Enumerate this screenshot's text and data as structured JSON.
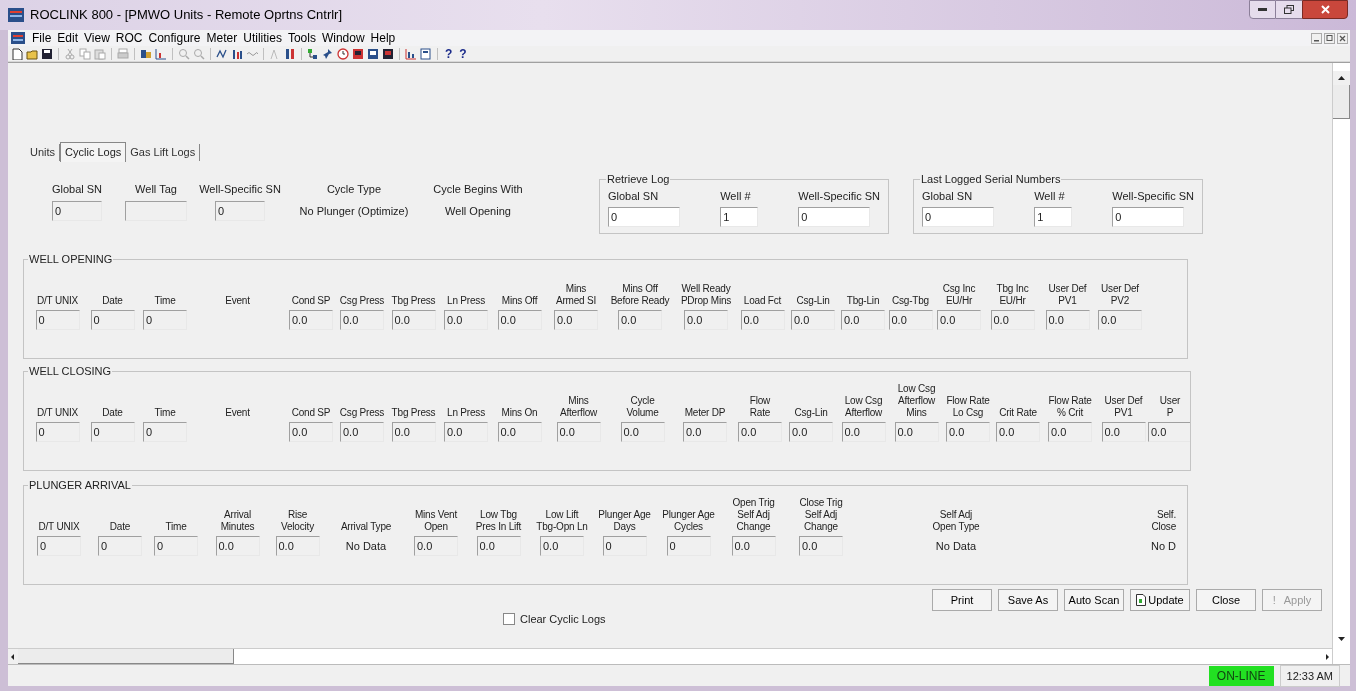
{
  "window": {
    "title": "ROCLINK 800 - [PMWO Units - Remote Oprtns Cntrlr]"
  },
  "menu": [
    "File",
    "Edit",
    "View",
    "ROC",
    "Configure",
    "Meter",
    "Utilities",
    "Tools",
    "Window",
    "Help"
  ],
  "toolbar_glyphs": [
    "?",
    "?"
  ],
  "tabs": [
    {
      "label": "Units",
      "selected": false
    },
    {
      "label": "Cyclic Logs",
      "selected": true
    },
    {
      "label": "Gas Lift Logs",
      "selected": false
    }
  ],
  "header_fields": [
    {
      "label": "Global SN",
      "kind": "field",
      "value": "0"
    },
    {
      "label": "Well Tag",
      "kind": "field"
    },
    {
      "label": "Well-Specific  SN",
      "kind": "field",
      "value": "0"
    },
    {
      "label": "Cycle Type",
      "kind": "text",
      "value": "No Plunger (Optimize)"
    },
    {
      "label": "Cycle Begins With",
      "kind": "text",
      "value": "Well Opening"
    }
  ],
  "retrieve_log": {
    "title": "Retrieve Log",
    "fields": [
      {
        "label": "Global SN",
        "value": "0"
      },
      {
        "label": "Well #",
        "value": "1"
      },
      {
        "label": "Well-Specific SN",
        "value": "0"
      }
    ]
  },
  "last_logged": {
    "title": "Last Logged Serial Numbers",
    "fields": [
      {
        "label": "Global SN",
        "value": "0"
      },
      {
        "label": "Well #",
        "value": "1"
      },
      {
        "label": "Well-Specific SN",
        "value": "0"
      }
    ]
  },
  "sections": [
    {
      "title": "WELL OPENING",
      "columns": [
        {
          "label": "D/T UNIX",
          "kind": "field",
          "value": "0"
        },
        {
          "label": "Date",
          "kind": "field",
          "value": "0"
        },
        {
          "label": "Time",
          "kind": "field",
          "value": "0"
        },
        {
          "label": "Event",
          "kind": "text"
        },
        {
          "label": "Cond SP",
          "kind": "field",
          "value": "0.0"
        },
        {
          "label": "Csg Press",
          "kind": "field",
          "value": "0.0"
        },
        {
          "label": "Tbg Press",
          "kind": "field",
          "value": "0.0"
        },
        {
          "label": "Ln Press",
          "kind": "field",
          "value": "0.0"
        },
        {
          "label": "Mins Off",
          "kind": "field",
          "value": "0.0"
        },
        {
          "label": "Mins\nArmed SI",
          "kind": "field",
          "value": "0.0"
        },
        {
          "label": "Mins Off\nBefore Ready",
          "kind": "field",
          "value": "0.0"
        },
        {
          "label": "Well Ready\nPDrop Mins",
          "kind": "field",
          "value": "0.0"
        },
        {
          "label": "Load Fct",
          "kind": "field",
          "value": "0.0"
        },
        {
          "label": "Csg-Lin",
          "kind": "field",
          "value": "0.0"
        },
        {
          "label": "Tbg-Lin",
          "kind": "field",
          "value": "0.0"
        },
        {
          "label": "Csg-Tbg",
          "kind": "field",
          "value": "0.0"
        },
        {
          "label": "Csg Inc\nEU/Hr",
          "kind": "field",
          "value": "0.0"
        },
        {
          "label": "Tbg Inc\nEU/Hr",
          "kind": "field",
          "value": "0.0"
        },
        {
          "label": "User Def\nPV1",
          "kind": "field",
          "value": "0.0"
        },
        {
          "label": "User Def\nPV2",
          "kind": "field",
          "value": "0.0"
        }
      ]
    },
    {
      "title": "WELL CLOSING",
      "columns": [
        {
          "label": "D/T UNIX",
          "kind": "field",
          "value": "0"
        },
        {
          "label": "Date",
          "kind": "field",
          "value": "0"
        },
        {
          "label": "Time",
          "kind": "field",
          "value": "0"
        },
        {
          "label": "Event",
          "kind": "text"
        },
        {
          "label": "Cond SP",
          "kind": "field",
          "value": "0.0"
        },
        {
          "label": "Csg Press",
          "kind": "field",
          "value": "0.0"
        },
        {
          "label": "Tbg Press",
          "kind": "field",
          "value": "0.0"
        },
        {
          "label": "Ln Press",
          "kind": "field",
          "value": "0.0"
        },
        {
          "label": "Mins On",
          "kind": "field",
          "value": "0.0"
        },
        {
          "label": "Mins\nAfterflow",
          "kind": "field",
          "value": "0.0"
        },
        {
          "label": "Cycle\nVolume",
          "kind": "field",
          "value": "0.0"
        },
        {
          "label": "Meter DP",
          "kind": "field",
          "value": "0.0"
        },
        {
          "label": "Flow\nRate",
          "kind": "field",
          "value": "0.0"
        },
        {
          "label": "Csg-Lin",
          "kind": "field",
          "value": "0.0"
        },
        {
          "label": "Low Csg\nAfterflow",
          "kind": "field",
          "value": "0.0"
        },
        {
          "label": "Low Csg\nAfterflow\nMins",
          "kind": "field",
          "value": "0.0"
        },
        {
          "label": "Flow Rate\nLo Csg",
          "kind": "field",
          "value": "0.0"
        },
        {
          "label": "Crit Rate",
          "kind": "field",
          "value": "0.0"
        },
        {
          "label": "Flow Rate\n% Crit",
          "kind": "field",
          "value": "0.0"
        },
        {
          "label": "User Def\nPV1",
          "kind": "field",
          "value": "0.0"
        },
        {
          "label": "User\nP",
          "kind": "field",
          "value": "0.0"
        }
      ]
    },
    {
      "title": "PLUNGER ARRIVAL",
      "columns": [
        {
          "label": "D/T UNIX",
          "kind": "field",
          "value": "0"
        },
        {
          "label": "Date",
          "kind": "field",
          "value": "0"
        },
        {
          "label": "Time",
          "kind": "field",
          "value": "0"
        },
        {
          "label": "Arrival\nMinutes",
          "kind": "field",
          "value": "0.0"
        },
        {
          "label": "Rise\nVelocity",
          "kind": "field",
          "value": "0.0"
        },
        {
          "label": "Arrival Type",
          "kind": "text",
          "value": "No Data"
        },
        {
          "label": "Mins Vent\nOpen",
          "kind": "field",
          "value": "0.0"
        },
        {
          "label": "Low Tbg\nPres In Lift",
          "kind": "field",
          "value": "0.0"
        },
        {
          "label": "Low Lift\nTbg-Opn Ln",
          "kind": "field",
          "value": "0.0"
        },
        {
          "label": "Plunger Age\nDays",
          "kind": "field",
          "value": "0"
        },
        {
          "label": "Plunger Age\nCycles",
          "kind": "field",
          "value": "0"
        },
        {
          "label": "Open Trig\nSelf Adj\nChange",
          "kind": "field",
          "value": "0.0"
        },
        {
          "label": "Close Trig\nSelf Adj\nChange",
          "kind": "field",
          "value": "0.0"
        },
        {
          "label": "Self Adj\nOpen Type",
          "kind": "text",
          "value": "No Data"
        },
        {
          "label": "Self.\nClose",
          "kind": "text",
          "value": "No D"
        }
      ]
    }
  ],
  "clear_logs": {
    "label": "Clear Cyclic Logs",
    "checked": false
  },
  "buttons": [
    {
      "label": "Print",
      "kind": "plain",
      "disabled": false
    },
    {
      "label": "Save As",
      "kind": "plain",
      "disabled": false
    },
    {
      "label": "Auto Scan",
      "kind": "plain",
      "disabled": false
    },
    {
      "label": "Update",
      "kind": "icon",
      "disabled": false
    },
    {
      "label": "Close",
      "kind": "plain",
      "disabled": false
    },
    {
      "label": "Apply",
      "kind": "glyph",
      "glyph": "!",
      "disabled": true
    }
  ],
  "status_bar": {
    "connection": "ON-LINE",
    "time": "12:33 AM"
  }
}
